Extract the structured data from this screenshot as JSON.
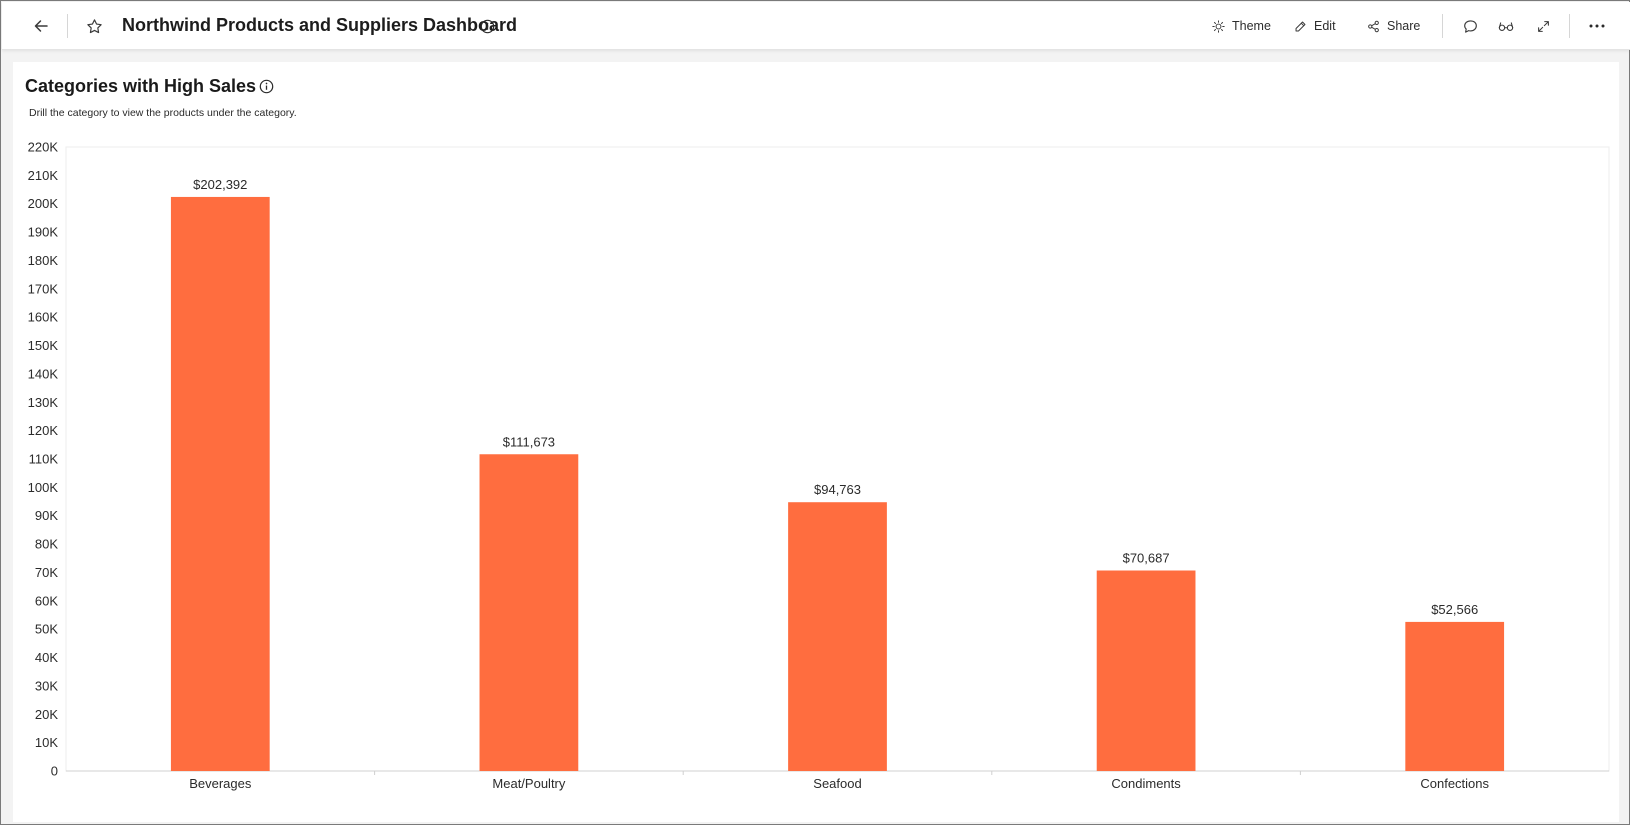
{
  "header": {
    "title": "Northwind Products and Suppliers Dashboard",
    "theme_label": "Theme",
    "edit_label": "Edit",
    "share_label": "Share"
  },
  "icons": {
    "back": "arrow-left-icon",
    "favorite": "star-icon",
    "info": "info-icon",
    "theme": "sun-icon",
    "edit": "pencil-icon",
    "share": "share-icon",
    "comment": "comment-icon",
    "glasses": "glasses-icon",
    "fullscreen": "expand-icon",
    "more": "more-dots-icon"
  },
  "card": {
    "title": "Categories with High Sales",
    "subtitle": "Drill the category to view the products under the category."
  },
  "colors": {
    "bar": "#FF6D3F",
    "grid": "#e8e8e8",
    "axis": "#d0d0d0"
  },
  "chart_data": {
    "type": "bar",
    "categories": [
      "Beverages",
      "Meat/Poultry",
      "Seafood",
      "Condiments",
      "Confections"
    ],
    "values": [
      202392,
      111673,
      94763,
      70687,
      52566
    ],
    "data_labels": [
      "$202,392",
      "$111,673",
      "$94,763",
      "$70,687",
      "$52,566"
    ],
    "ylim": [
      0,
      220000
    ],
    "y_ticks": [
      0,
      10000,
      20000,
      30000,
      40000,
      50000,
      60000,
      70000,
      80000,
      90000,
      100000,
      110000,
      120000,
      130000,
      140000,
      150000,
      160000,
      170000,
      180000,
      190000,
      200000,
      210000,
      220000
    ],
    "y_tick_labels": [
      "0",
      "10K",
      "20K",
      "30K",
      "40K",
      "50K",
      "60K",
      "70K",
      "80K",
      "90K",
      "100K",
      "110K",
      "120K",
      "130K",
      "140K",
      "150K",
      "160K",
      "170K",
      "180K",
      "190K",
      "200K",
      "210K",
      "220K"
    ],
    "grid": false,
    "legend": "none"
  }
}
